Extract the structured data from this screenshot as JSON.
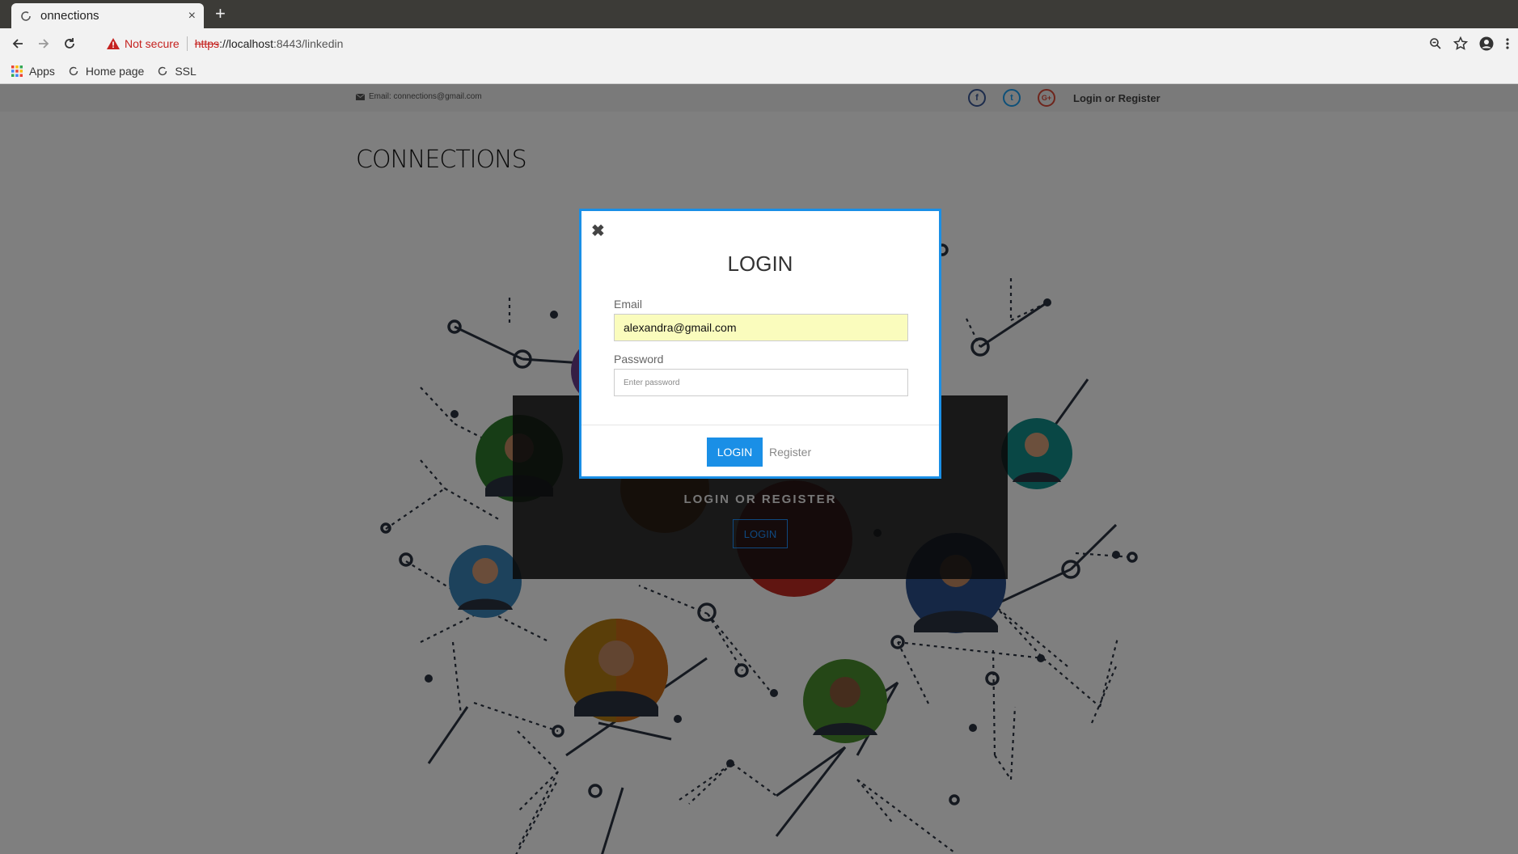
{
  "browser": {
    "tab_title": "onnections",
    "tab_close": "×",
    "new_tab": "+",
    "security_label": "Not secure",
    "url_protocol": "https",
    "url_host": "://localhost",
    "url_rest": ":8443/linkedin",
    "bookmarks": [
      {
        "label": "Apps",
        "icon": "apps-grid-icon"
      },
      {
        "label": "Home page",
        "icon": "page-icon"
      },
      {
        "label": "SSL",
        "icon": "page-icon"
      }
    ]
  },
  "site": {
    "email_text": "Email: connections@gmail.com",
    "login_or_register": "Login or Register",
    "logo": "CONNECTIONS",
    "social": [
      {
        "icon": "facebook-icon",
        "glyph": "f",
        "color": "#3b5998"
      },
      {
        "icon": "twitter-icon",
        "glyph": "t",
        "color": "#1da1f2"
      },
      {
        "icon": "google-plus-icon",
        "glyph": "G+",
        "color": "#dd4b39"
      }
    ],
    "hero_title": "LOGIN OR REGISTER",
    "hero_button": "LOGIN"
  },
  "modal": {
    "close_glyph": "✖",
    "title": "LOGIN",
    "email_label": "Email",
    "email_value": "alexandra@gmail.com",
    "password_label": "Password",
    "password_placeholder": "Enter password",
    "login_button": "LOGIN",
    "register_link": "Register"
  },
  "colors": {
    "accent": "#1a8fe6",
    "warning": "#c5221f",
    "autofill": "#fafcbd"
  }
}
